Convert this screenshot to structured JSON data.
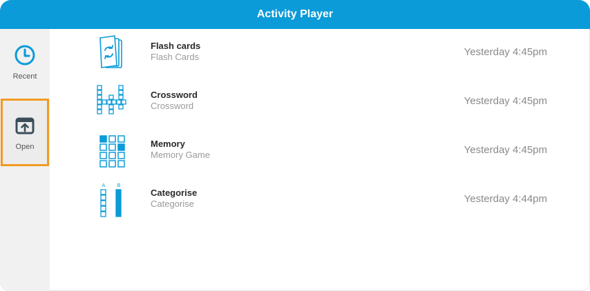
{
  "window": {
    "title": "Activity Player"
  },
  "sidebar": {
    "items": [
      {
        "label": "Recent",
        "icon": "clock-icon"
      },
      {
        "label": "Open",
        "icon": "open-folder-icon",
        "selected": true
      }
    ]
  },
  "activities": [
    {
      "title": "Flash cards",
      "subtitle": "Flash Cards",
      "time": "Yesterday 4:45pm",
      "icon": "flash-cards-icon"
    },
    {
      "title": "Crossword",
      "subtitle": "Crossword",
      "time": "Yesterday 4:45pm",
      "icon": "crossword-icon"
    },
    {
      "title": "Memory",
      "subtitle": "Memory Game",
      "time": "Yesterday 4:45pm",
      "icon": "memory-grid-icon"
    },
    {
      "title": "Categorise",
      "subtitle": "Categorise",
      "time": "Yesterday 4:44pm",
      "icon": "categorise-columns-icon"
    }
  ],
  "colors": {
    "accent": "#0a9bd8",
    "selection": "#f39a1f",
    "sidebar": "#f1f1f1"
  }
}
